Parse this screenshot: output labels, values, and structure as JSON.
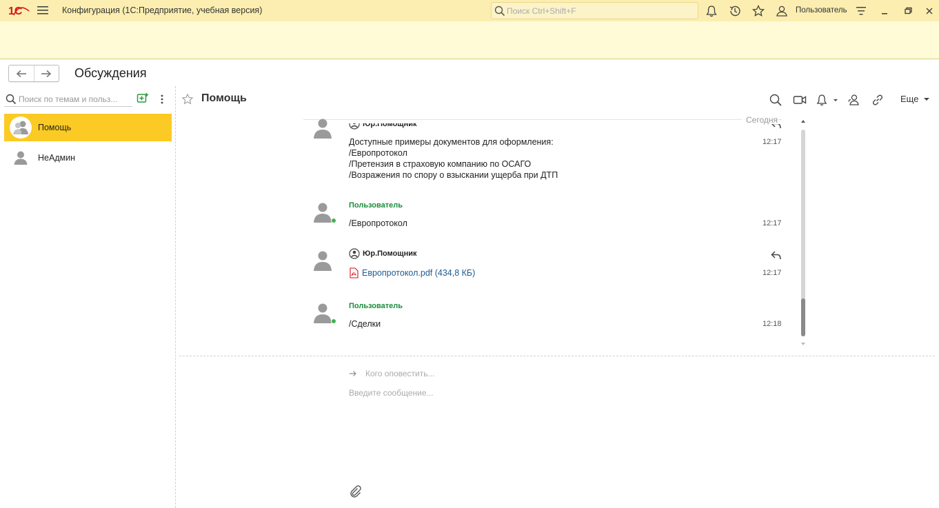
{
  "window": {
    "title": "Конфигурация  (1С:Предприятие, учебная версия)",
    "search_placeholder": "Поиск Ctrl+Shift+F",
    "user_name": "Пользователь"
  },
  "page": {
    "title": "Обсуждения"
  },
  "sidebar": {
    "search_placeholder": "Поиск по темам и польз...",
    "conversations": [
      {
        "label": "Помощь",
        "active": true
      },
      {
        "label": "НеАдмин",
        "active": false
      }
    ]
  },
  "chat": {
    "title": "Помощь",
    "more_label": "Еще",
    "date_label": "Сегодня",
    "messages": [
      {
        "author": "Юр.Помощник",
        "text": "Доступные примеры документов для оформления:\n/Европротокол\n/Претензия в страховую компанию по ОСАГО\n/Возражения по спору о взыскании ущерба при ДТП",
        "time": "12:17"
      },
      {
        "author": "Пользователь",
        "text": "/Европротокол",
        "time": "12:17"
      },
      {
        "author": "Юр.Помощник",
        "file": "Европротокол.pdf (434,8 КБ)",
        "time": "12:17"
      },
      {
        "author": "Пользователь",
        "text": "/Сделки",
        "time": "12:18"
      }
    ],
    "scroll_position": 1.0
  },
  "compose": {
    "notify_placeholder": "Кого оповестить...",
    "message_placeholder": "Введите сообщение..."
  },
  "colors": {
    "titlebar": "#fbeeb0",
    "active_conversation": "#fbca25",
    "user_author": "#1a8d3a",
    "link": "#1f5a91",
    "online": "#3fb34f"
  },
  "icons": [
    "logo-1c",
    "menu-icon",
    "search-icon",
    "bell-icon",
    "history-icon",
    "star-icon",
    "user-icon",
    "settings-icon",
    "minimize-icon",
    "restore-icon",
    "back-arrow-icon",
    "forward-arrow-icon",
    "add-topic-icon",
    "more-vert-icon",
    "video-icon",
    "link-icon",
    "members-icon",
    "reply-icon",
    "pdf-icon",
    "attach-icon"
  ]
}
